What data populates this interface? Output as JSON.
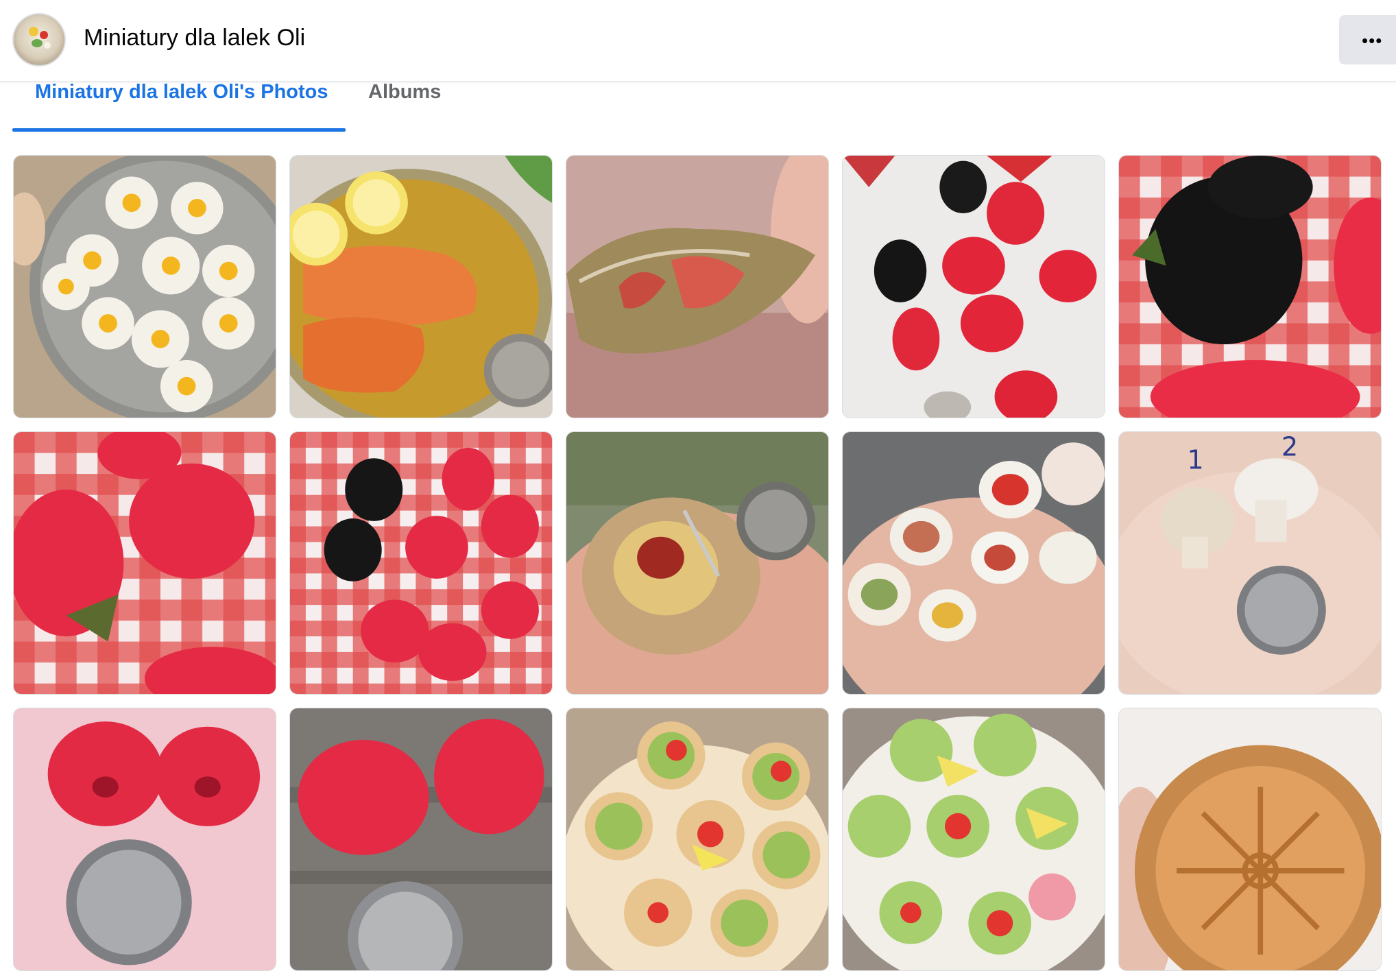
{
  "page": {
    "name": "Miniatury dla lalek Oli",
    "more_label": "•••"
  },
  "tabs": [
    {
      "label": "Miniatury dla lalek Oli's Photos",
      "active": true
    },
    {
      "label": "Albums",
      "active": false
    }
  ],
  "colors": {
    "accent": "#1b74e4",
    "tab_inactive": "#65676b",
    "button_bg": "#e4e6eb"
  },
  "photos": [
    {
      "subject": "quail eggs on plate"
    },
    {
      "subject": "salmon with lemon in oil"
    },
    {
      "subject": "glossy clay bread roll"
    },
    {
      "subject": "raspberry and blackberry earrings"
    },
    {
      "subject": "blackberry on checkered cloth"
    },
    {
      "subject": "raspberry earrings on checkered cloth"
    },
    {
      "subject": "raspberries and blackberries on checkered cloth"
    },
    {
      "subject": "spaghetti plate with coin"
    },
    {
      "subject": "miniature dinner plates on hand"
    },
    {
      "subject": "two mushrooms with coin"
    },
    {
      "subject": "raspberries on pink with coin"
    },
    {
      "subject": "raspberries on wood with coin"
    },
    {
      "subject": "open sandwiches on plate"
    },
    {
      "subject": "open sandwiches with salad"
    },
    {
      "subject": "braided pie"
    }
  ]
}
